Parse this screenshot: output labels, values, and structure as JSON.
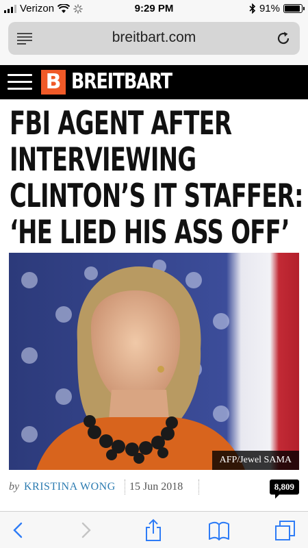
{
  "status": {
    "carrier": "Verizon",
    "time": "9:29 PM",
    "battery": "91%",
    "battery_level": 0.91,
    "icons": [
      "signal-bars-icon",
      "wifi-icon",
      "activity-spinner-icon",
      "bluetooth-icon",
      "battery-icon"
    ]
  },
  "browser": {
    "url": "breitbart.com",
    "icons": [
      "reader-mode-icon",
      "reload-icon"
    ]
  },
  "site": {
    "logo_letter": "B",
    "name": "BREITBART",
    "brand_color": "#f05a28"
  },
  "article": {
    "headline_lines": [
      "FBI AGENT AFTER",
      "INTERVIEWING",
      "CLINTON’S IT STAFFER:",
      "‘HE LIED HIS ASS OFF’"
    ],
    "photo_caption": "AFP/Jewel SAMA",
    "by": "by",
    "author": "KRISTINA WONG",
    "date": "15 Jun 2018",
    "comments": "8,809"
  },
  "toolbar": {
    "icons": [
      "back-icon",
      "forward-icon",
      "share-icon",
      "bookmarks-icon",
      "tabs-icon"
    ]
  }
}
